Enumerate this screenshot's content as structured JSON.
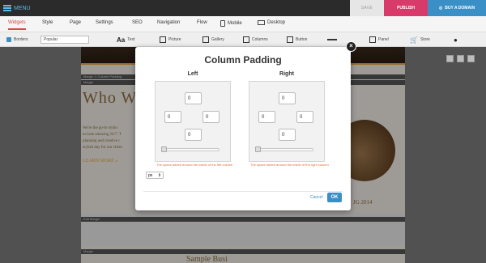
{
  "topbar": {
    "menu_label": "MENU",
    "save_label": "SAVE",
    "publish_label": "PUBLISH",
    "domain_label": "BUY A DOMAIN"
  },
  "tabs": [
    {
      "label": "Widgets"
    },
    {
      "label": "Style"
    },
    {
      "label": "Page"
    },
    {
      "label": "Settings"
    },
    {
      "label": "SEO"
    },
    {
      "label": "Navigation"
    },
    {
      "label": "Flow"
    },
    {
      "label": "Mobile"
    },
    {
      "label": "Desktop"
    }
  ],
  "widgets": {
    "borders_label": "Borders",
    "filter_value": "Popular",
    "items": [
      {
        "label": "Text"
      },
      {
        "label": "Picture"
      },
      {
        "label": "Gallery"
      },
      {
        "label": "Columns"
      },
      {
        "label": "Button"
      },
      {
        "label": "Panel"
      },
      {
        "label": "Store"
      }
    ]
  },
  "background": {
    "margin_label_1": "Margin ◇ Column Padding",
    "margin_label_2": "Margin",
    "heading": "Who W",
    "body_lines": [
      "We're the go-to stylin",
      "to look amazing 24/7. T",
      "planning and creative c",
      "stylish day for our client"
    ],
    "learn_more": "LEARN MORE »",
    "date": "JG 2014",
    "edit_label": "Edit",
    "margin_label_3": "Margin",
    "margin_label_4": "Margin",
    "bottom_heading": "Sample Busi"
  },
  "modal": {
    "title": "Column Padding",
    "left": {
      "title": "Left",
      "top": "0",
      "left": "0",
      "right": "0",
      "bottom": "0",
      "help": "The space added around the inside of the left column"
    },
    "right": {
      "title": "Right",
      "top": "0",
      "left": "0",
      "right": "0",
      "bottom": "0",
      "help": "The space added around the inside of the right column"
    },
    "unit": "px",
    "cancel_label": "Cancel",
    "ok_label": "OK"
  }
}
